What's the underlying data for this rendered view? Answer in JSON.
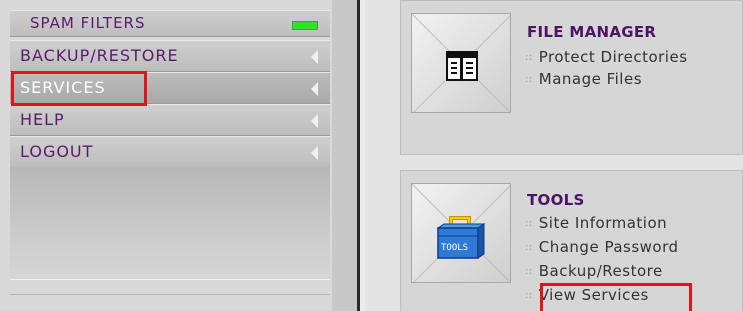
{
  "sidebar": {
    "items": [
      {
        "label": "SPAM FILTERS"
      },
      {
        "label": "BACKUP/RESTORE"
      },
      {
        "label": "SERVICES"
      },
      {
        "label": "HELP"
      },
      {
        "label": "LOGOUT"
      }
    ]
  },
  "panels": {
    "file_manager": {
      "title": "FILE MANAGER",
      "links": [
        "Protect Directories",
        "Manage Files"
      ]
    },
    "tools": {
      "title": "TOOLS",
      "icon_text": "TOOLS",
      "links": [
        "Site Information",
        "Change Password",
        "Backup/Restore",
        "View Services"
      ]
    }
  },
  "colors": {
    "accent": "#4d1466",
    "highlight": "#e0141c",
    "status_green": "#31e02a"
  },
  "icons": [
    "file-manager-icon",
    "toolbox-icon",
    "arrow-left-icon",
    "bullet-icon"
  ]
}
